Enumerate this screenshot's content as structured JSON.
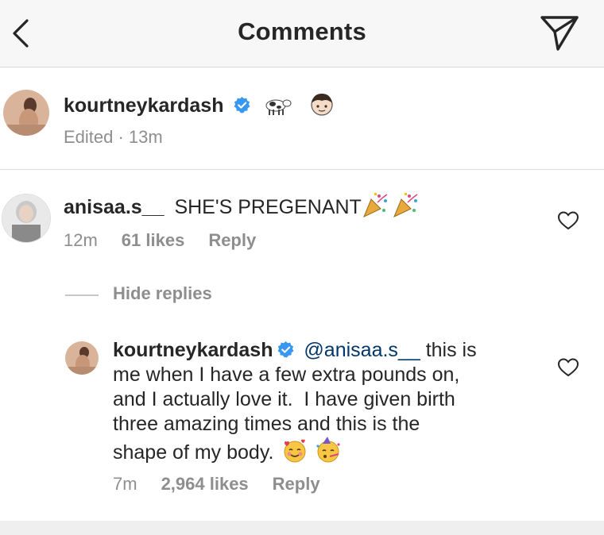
{
  "header": {
    "title": "Comments",
    "back_icon": "chevron-left-icon",
    "send_icon": "paper-plane-icon"
  },
  "caption": {
    "username": "kourtneykardash",
    "emojis": [
      "cow-emoji",
      "girl-face-emoji"
    ],
    "meta": "Edited · 13m"
  },
  "comment": {
    "username": "anisaa.s__",
    "text": "SHE'S PREGENANT",
    "emojis": [
      "party-popper-emoji",
      "party-popper-emoji"
    ],
    "time": "12m",
    "likes": "61 likes",
    "reply_label": "Reply"
  },
  "hide_replies_label": "Hide replies",
  "reply": {
    "username": "kourtneykardash",
    "mention": "@anisaa.s__",
    "line1_rest": "this is",
    "line2": "me when I have a few extra pounds on,",
    "line3": "and I actually love it.  I have given birth",
    "line4": "three amazing times and this is the",
    "line5": "shape of my body.",
    "emojis": [
      "smiling-face-with-hearts-emoji",
      "partying-face-emoji"
    ],
    "time": "7m",
    "likes": "2,964 likes",
    "reply_label": "Reply"
  },
  "colors": {
    "text": "#262626",
    "secondary": "#8e8e8e",
    "mention": "#00376b",
    "verified": "#3897f0",
    "header_bg": "#f7f7f7"
  }
}
